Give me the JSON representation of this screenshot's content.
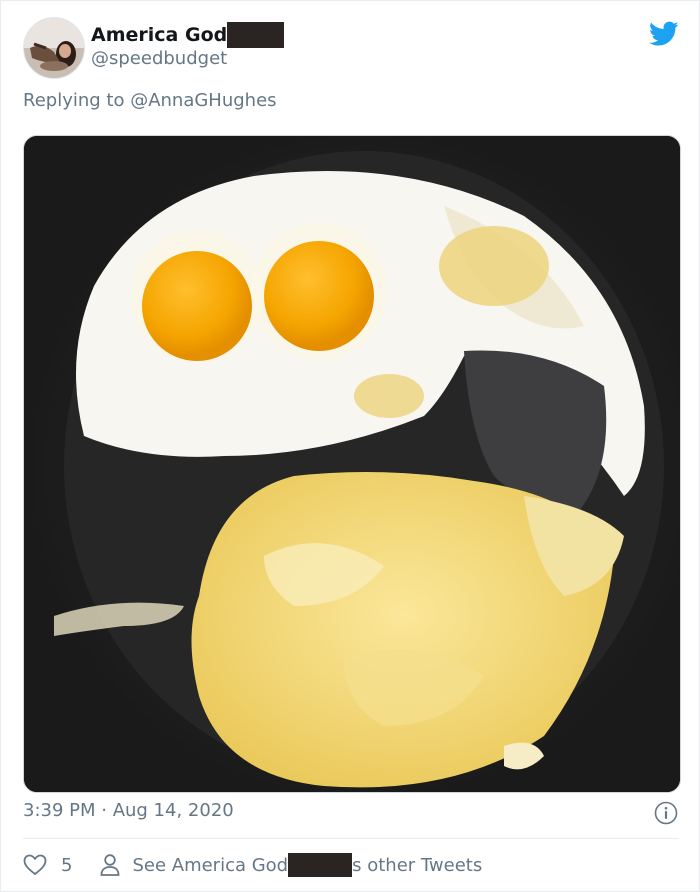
{
  "tweet": {
    "display_name": "America God",
    "display_name_suffix": "",
    "handle": "@speedbudget",
    "replying_prefix": "Replying to ",
    "replying_to": "@AnnaGHughes",
    "timestamp": "3:39 PM · Aug 14, 2020",
    "likes": "5",
    "see_more_prefix": "See America God",
    "see_more_suffix": "s other Tweets"
  },
  "colors": {
    "twitter_blue": "#1da1f2",
    "secondary_text": "#657786",
    "primary_text": "#14171a"
  },
  "icons": {
    "logo": "twitter-bird-icon",
    "info": "info-icon",
    "like": "heart-icon",
    "profile": "person-icon"
  }
}
